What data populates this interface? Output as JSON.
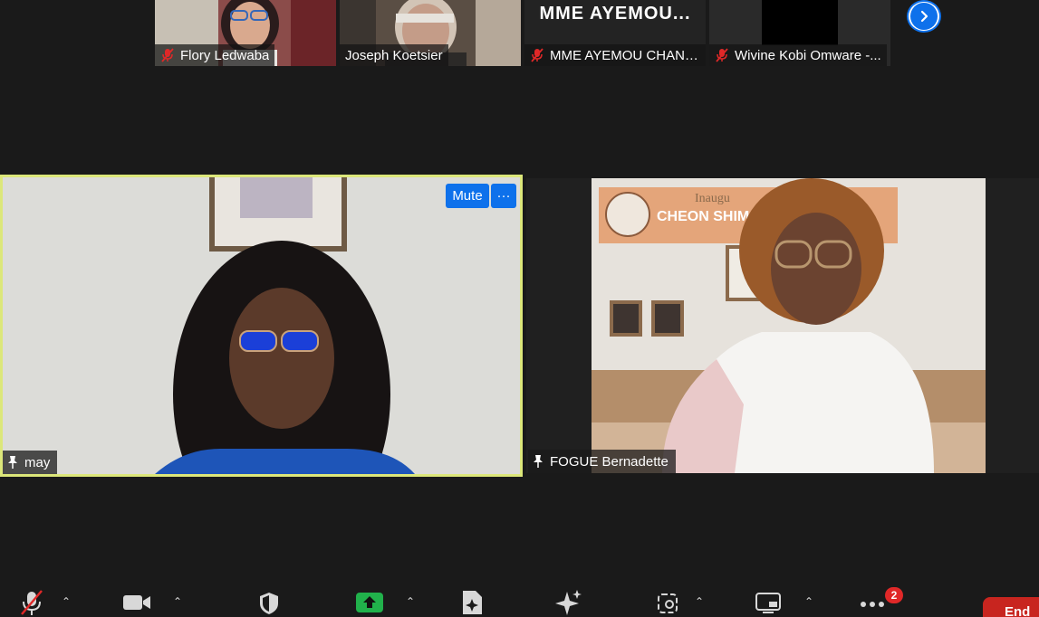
{
  "gallery": {
    "participants": [
      {
        "name": "Flory Ledwaba",
        "muted": true
      },
      {
        "name": "Joseph Koetsier",
        "muted": false
      },
      {
        "name": "MME AYEMOU CHANT...",
        "muted": true,
        "tile_text": "MME  AYEMOU..."
      },
      {
        "name": "Wivine Kobi Omware -...",
        "muted": true
      }
    ],
    "next_icon": "chevron-right-icon"
  },
  "main": {
    "speaker_left": {
      "name": "may",
      "mute_label": "Mute",
      "more_label": "···",
      "highlight_color": "#dce77a"
    },
    "speaker_right": {
      "name": "FOGUE Bernadette",
      "poster_text": "CHEON SHIM",
      "poster_top": "Inaugu"
    }
  },
  "toolbar": {
    "icons": [
      "mic-muted-icon",
      "video-camera-icon",
      "security-shield-icon",
      "share-screen-icon",
      "whiteboard-icon",
      "ai-companion-icon",
      "apps-icon",
      "view-icon",
      "more-icon"
    ],
    "more_badge": "2",
    "end_label": "End",
    "accent": "#0e71eb",
    "share_color": "#21b14b",
    "end_color": "#c8251f"
  }
}
